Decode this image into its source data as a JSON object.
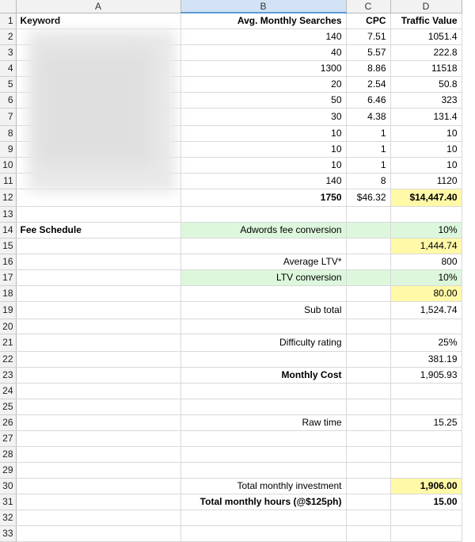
{
  "columns": [
    "A",
    "B",
    "C",
    "D"
  ],
  "selected_column": "B",
  "header": {
    "keyword": "Keyword",
    "avg_searches": "Avg. Monthly Searches",
    "cpc": "CPC",
    "traffic_value": "Traffic Value"
  },
  "data_rows": [
    {
      "row": "2",
      "searches": "140",
      "cpc": "7.51",
      "value": "1051.4"
    },
    {
      "row": "3",
      "searches": "40",
      "cpc": "5.57",
      "value": "222.8"
    },
    {
      "row": "4",
      "searches": "1300",
      "cpc": "8.86",
      "value": "11518"
    },
    {
      "row": "5",
      "searches": "20",
      "cpc": "2.54",
      "value": "50.8"
    },
    {
      "row": "6",
      "searches": "50",
      "cpc": "6.46",
      "value": "323"
    },
    {
      "row": "7",
      "searches": "30",
      "cpc": "4.38",
      "value": "131.4"
    },
    {
      "row": "8",
      "searches": "10",
      "cpc": "1",
      "value": "10"
    },
    {
      "row": "9",
      "searches": "10",
      "cpc": "1",
      "value": "10"
    },
    {
      "row": "10",
      "searches": "10",
      "cpc": "1",
      "value": "10"
    },
    {
      "row": "11",
      "searches": "140",
      "cpc": "8",
      "value": "1120"
    }
  ],
  "totals": {
    "row": "12",
    "searches": "1750",
    "cpc": "$46.32",
    "value": "$14,447.40"
  },
  "fee": {
    "title": "Fee Schedule",
    "adwords_label": "Adwords fee conversion",
    "adwords_pct": "10%",
    "adwords_value": "1,444.74",
    "ltv_label": "Average LTV*",
    "ltv_value": "800",
    "ltv_conv_label": "LTV conversion",
    "ltv_conv_pct": "10%",
    "ltv_conv_value": "80.00",
    "subtotal_label": "Sub total",
    "subtotal_value": "1,524.74",
    "difficulty_label": "Difficulty rating",
    "difficulty_pct": "25%",
    "difficulty_value": "381.19",
    "monthly_cost_label": "Monthly Cost",
    "monthly_cost_value": "1,905.93",
    "raw_time_label": "Raw time",
    "raw_time_value": "15.25",
    "investment_label": "Total monthly investment",
    "investment_value": "1,906.00",
    "hours_label": "Total monthly hours  (@$125ph)",
    "hours_value": "15.00"
  },
  "row_numbers": [
    "1",
    "2",
    "3",
    "4",
    "5",
    "6",
    "7",
    "8",
    "9",
    "10",
    "11",
    "12",
    "13",
    "14",
    "15",
    "16",
    "17",
    "18",
    "19",
    "20",
    "21",
    "22",
    "23",
    "24",
    "25",
    "26",
    "27",
    "28",
    "29",
    "30",
    "31",
    "32",
    "33"
  ],
  "colors": {
    "green": "#ddf7dd",
    "yellow": "#fff9a8",
    "selected_header": "#d3e3f5"
  }
}
